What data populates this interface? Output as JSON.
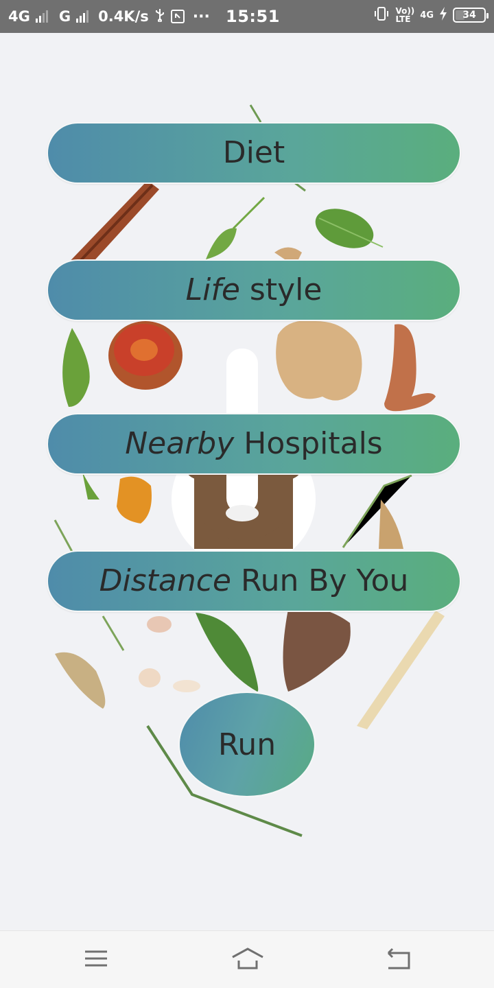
{
  "status_bar": {
    "network1": "4G",
    "network2": "G",
    "speed": "0.4K/s",
    "more": "···",
    "time": "15:51",
    "volte_top": "Vo))",
    "volte_bottom": "LTE",
    "network3": "4G",
    "battery": "34"
  },
  "buttons": {
    "diet": "Diet",
    "life_italic": "Life",
    "life_rest": " style",
    "nearby_italic": "Nearby",
    "nearby_rest": " Hospitals",
    "distance_italic": "Distance",
    "distance_rest": " Run By You",
    "run": "Run"
  },
  "nav_bar": {
    "menu_icon": "menu-icon",
    "home_icon": "home-icon",
    "back_icon": "back-icon"
  },
  "colors": {
    "button_gradient_start": "#4f8caa",
    "button_gradient_end": "#5aae7d",
    "status_bar": "#707070",
    "background": "#f1f2f5"
  }
}
